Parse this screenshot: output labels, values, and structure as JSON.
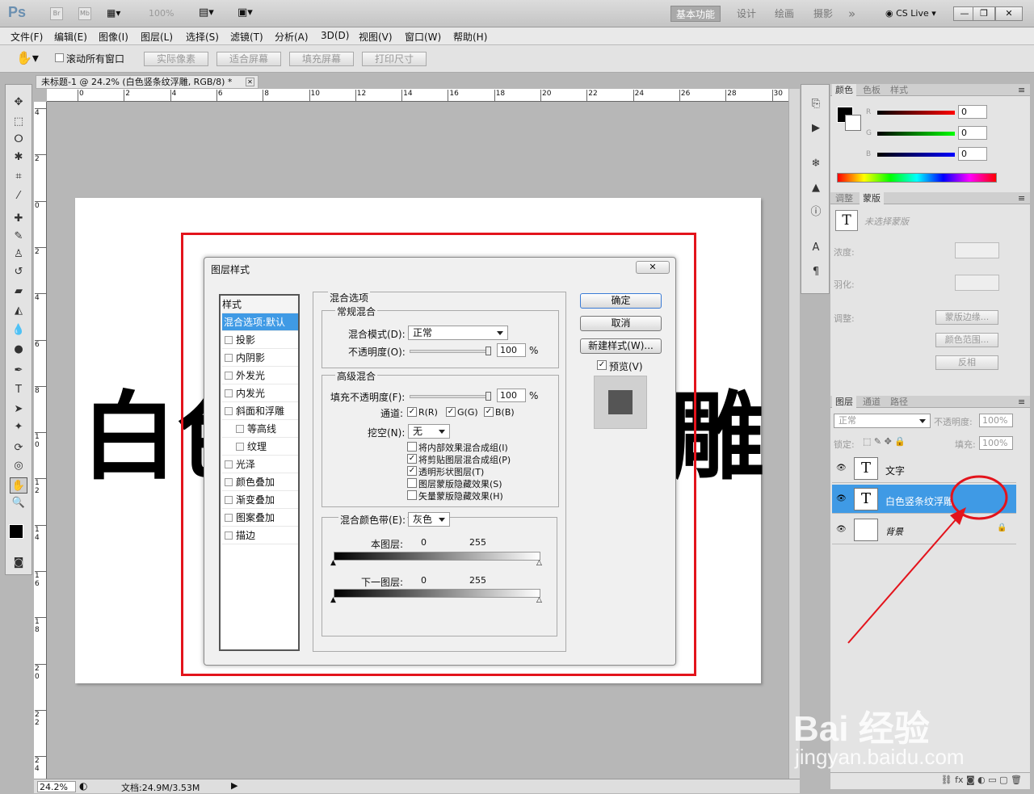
{
  "app": {
    "logo": "Ps",
    "br": "Br",
    "mb": "Mb",
    "zoom": "100%",
    "workspaces": [
      "基本功能",
      "设计",
      "绘画",
      "摄影"
    ],
    "more": "»",
    "cslive": "CS Live ▾"
  },
  "menu": [
    "文件(F)",
    "编辑(E)",
    "图像(I)",
    "图层(L)",
    "选择(S)",
    "滤镜(T)",
    "分析(A)",
    "3D(D)",
    "视图(V)",
    "窗口(W)",
    "帮助(H)"
  ],
  "options": {
    "scroll_all": "滚动所有窗口",
    "actual_pixels": "实际像素",
    "fit_screen": "适合屏幕",
    "fill_screen": "填充屏幕",
    "print_size": "打印尺寸"
  },
  "document": {
    "tab": "未标题-1 @ 24.2% (白色竖条纹浮雕, RGB/8) *",
    "canvas_text_left": "白色",
    "canvas_text_right": "雕",
    "zoom": "24.2%",
    "doc_size": "文档:24.9M/3.53M"
  },
  "ruler": {
    "h": [
      "0",
      "2",
      "4",
      "6",
      "8",
      "10",
      "12",
      "14",
      "16",
      "18",
      "20",
      "22",
      "24",
      "26",
      "28",
      "30"
    ],
    "v": [
      "4",
      "2",
      "0",
      "2",
      "4",
      "6",
      "8",
      "1\n0",
      "1\n2",
      "1\n4",
      "1\n6",
      "1\n8",
      "2\n0",
      "2\n2",
      "2\n4"
    ]
  },
  "dialog": {
    "title": "图层样式",
    "close": "✕",
    "styles_header": "样式",
    "styles": [
      "混合选项:默认",
      "投影",
      "内阴影",
      "外发光",
      "内发光",
      "斜面和浮雕",
      "等高线",
      "纹理",
      "光泽",
      "颜色叠加",
      "渐变叠加",
      "图案叠加",
      "描边"
    ],
    "blend_options": "混合选项",
    "general": "常规混合",
    "blend_mode_label": "混合模式(D):",
    "blend_mode": "正常",
    "opacity_label": "不透明度(O):",
    "opacity": "100",
    "percent": "%",
    "advanced": "高级混合",
    "fill_label": "填充不透明度(F):",
    "fill": "100",
    "channels_label": "通道:",
    "ch_r": "R(R)",
    "ch_g": "G(G)",
    "ch_b": "B(B)",
    "knockout_label": "挖空(N):",
    "knockout": "无",
    "opts": [
      "将内部效果混合成组(I)",
      "将剪贴图层混合成组(P)",
      "透明形状图层(T)",
      "图层蒙版隐藏效果(S)",
      "矢量蒙版隐藏效果(H)"
    ],
    "opts_checked": [
      false,
      true,
      true,
      false,
      false
    ],
    "blend_if_label": "混合颜色带(E):",
    "blend_if": "灰色",
    "this_layer": "本图层:",
    "under_layer": "下一图层:",
    "v0": "0",
    "v255": "255",
    "ok": "确定",
    "cancel": "取消",
    "new_style": "新建样式(W)...",
    "preview": "预览(V)"
  },
  "panels": {
    "color_tabs": [
      "颜色",
      "色板",
      "样式"
    ],
    "rgb": [
      "R",
      "G",
      "B"
    ],
    "rgb_vals": [
      "0",
      "0",
      "0"
    ],
    "adj_tabs": [
      "调整",
      "蒙版"
    ],
    "mask_none": "未选择蒙版",
    "density": "浓度:",
    "feather": "羽化:",
    "refine": "调整:",
    "mask_edge": "蒙版边缘...",
    "color_range": "颜色范围...",
    "invert": "反相",
    "layer_tabs": [
      "图层",
      "通道",
      "路径"
    ],
    "blend": "正常",
    "opacity_label": "不透明度:",
    "opacity": "100%",
    "lock": "锁定:",
    "fill_label": "填充:",
    "fill": "100%",
    "layers": [
      {
        "name": "文字",
        "type": "T"
      },
      {
        "name": "白色竖条纹浮雕",
        "type": "T"
      },
      {
        "name": "背景",
        "type": ""
      }
    ]
  },
  "watermark": {
    "brand": "Bai 经验",
    "url": "jingyan.baidu.com"
  },
  "colors": {
    "highlight_red": "#e3141c",
    "selected_blue": "#3f9ae5"
  }
}
